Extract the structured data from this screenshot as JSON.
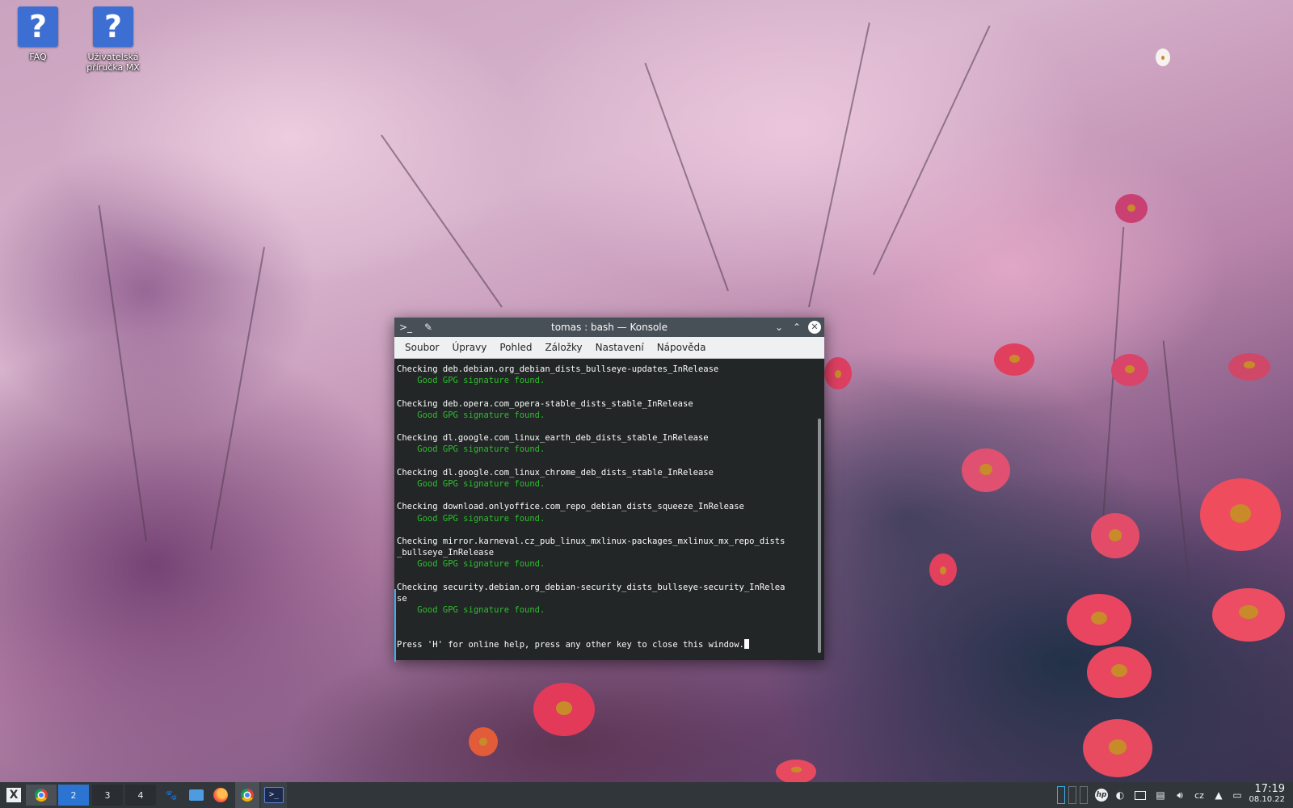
{
  "desktop": {
    "icons": [
      {
        "label": "FAQ",
        "glyph": "?"
      },
      {
        "label": "Uživatelská příručka MX",
        "glyph": "?"
      }
    ]
  },
  "window": {
    "title": "tomas : bash — Konsole",
    "menu": [
      "Soubor",
      "Úpravy",
      "Pohled",
      "Záložky",
      "Nastavení",
      "Nápověda"
    ],
    "terminal_lines": [
      {
        "text": "Checking deb.debian.org_debian_dists_bullseye-updates_InRelease",
        "kind": "normal"
      },
      {
        "text": "    Good GPG signature found.",
        "kind": "good"
      },
      {
        "text": "",
        "kind": "normal"
      },
      {
        "text": "Checking deb.opera.com_opera-stable_dists_stable_InRelease",
        "kind": "normal"
      },
      {
        "text": "    Good GPG signature found.",
        "kind": "good"
      },
      {
        "text": "",
        "kind": "normal"
      },
      {
        "text": "Checking dl.google.com_linux_earth_deb_dists_stable_InRelease",
        "kind": "normal"
      },
      {
        "text": "    Good GPG signature found.",
        "kind": "good"
      },
      {
        "text": "",
        "kind": "normal"
      },
      {
        "text": "Checking dl.google.com_linux_chrome_deb_dists_stable_InRelease",
        "kind": "normal"
      },
      {
        "text": "    Good GPG signature found.",
        "kind": "good"
      },
      {
        "text": "",
        "kind": "normal"
      },
      {
        "text": "Checking download.onlyoffice.com_repo_debian_dists_squeeze_InRelease",
        "kind": "normal"
      },
      {
        "text": "    Good GPG signature found.",
        "kind": "good"
      },
      {
        "text": "",
        "kind": "normal"
      },
      {
        "text": "Checking mirror.karneval.cz_pub_linux_mxlinux-packages_mxlinux_mx_repo_dists",
        "kind": "normal"
      },
      {
        "text": "_bullseye_InRelease",
        "kind": "normal"
      },
      {
        "text": "    Good GPG signature found.",
        "kind": "good"
      },
      {
        "text": "",
        "kind": "normal"
      },
      {
        "text": "Checking security.debian.org_debian-security_dists_bullseye-security_InReleа",
        "kind": "normal"
      },
      {
        "text": "se",
        "kind": "normal"
      },
      {
        "text": "    Good GPG signature found.",
        "kind": "good"
      },
      {
        "text": "",
        "kind": "normal"
      },
      {
        "text": "",
        "kind": "normal"
      },
      {
        "text": "Press 'H' for online help, press any other key to close this window.",
        "kind": "prompt"
      }
    ]
  },
  "taskbar": {
    "pager": [
      "2",
      "3",
      "4"
    ],
    "layout_indicator": "cz",
    "clock_time": "17:19",
    "clock_date": "08.10.22"
  },
  "colors": {
    "terminal_bg": "#232627",
    "terminal_good": "#2ebd2e",
    "titlebar": "#475057",
    "taskbar": "#31363b",
    "desktop_icon": "#3d6fd3"
  }
}
